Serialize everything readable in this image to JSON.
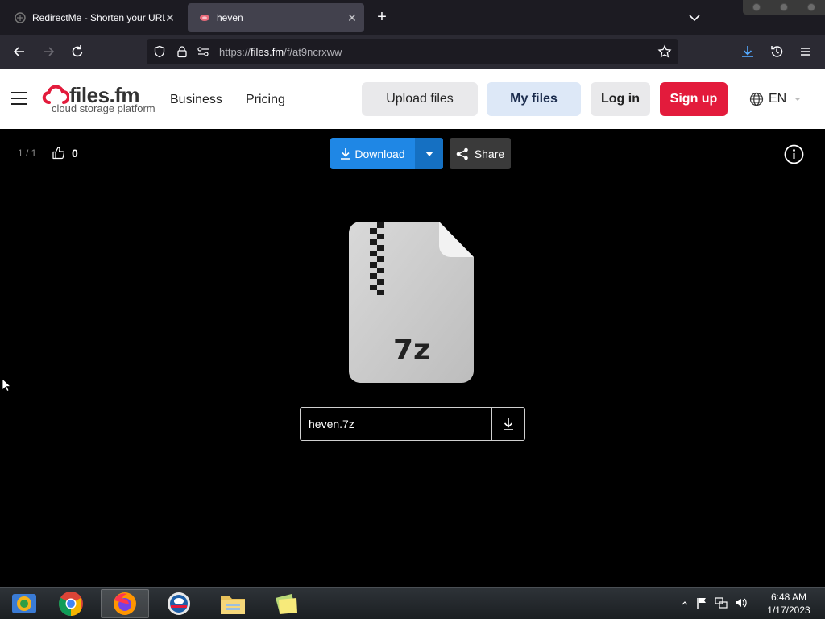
{
  "browser": {
    "tabs": [
      {
        "title": "RedirectMe - Shorten your URL",
        "active": false
      },
      {
        "title": "heven",
        "active": true
      }
    ],
    "url": {
      "prefix": "https://",
      "domain": "files.fm",
      "path": "/f/at9ncrxww"
    }
  },
  "site": {
    "logo_name": "files.fm",
    "logo_tagline": "cloud storage platform",
    "nav": {
      "business": "Business",
      "pricing": "Pricing"
    },
    "buttons": {
      "upload": "Upload files",
      "my_files": "My files",
      "login": "Log in",
      "signup": "Sign up"
    },
    "language": "EN",
    "colors": {
      "signup": "#e31b3c",
      "download": "#1f87e5"
    }
  },
  "viewer": {
    "counter": "1 / 1",
    "likes": "0",
    "download_label": "Download",
    "share_label": "Share",
    "file_type_label": "7z",
    "file_name": "heven.7z"
  },
  "taskbar": {
    "apps": [
      "windows-explorer-icon",
      "chrome-icon",
      "firefox-icon",
      "opera-icon",
      "file-explorer-icon",
      "sticky-notes-icon"
    ],
    "time": "6:48 AM",
    "date": "1/17/2023"
  }
}
